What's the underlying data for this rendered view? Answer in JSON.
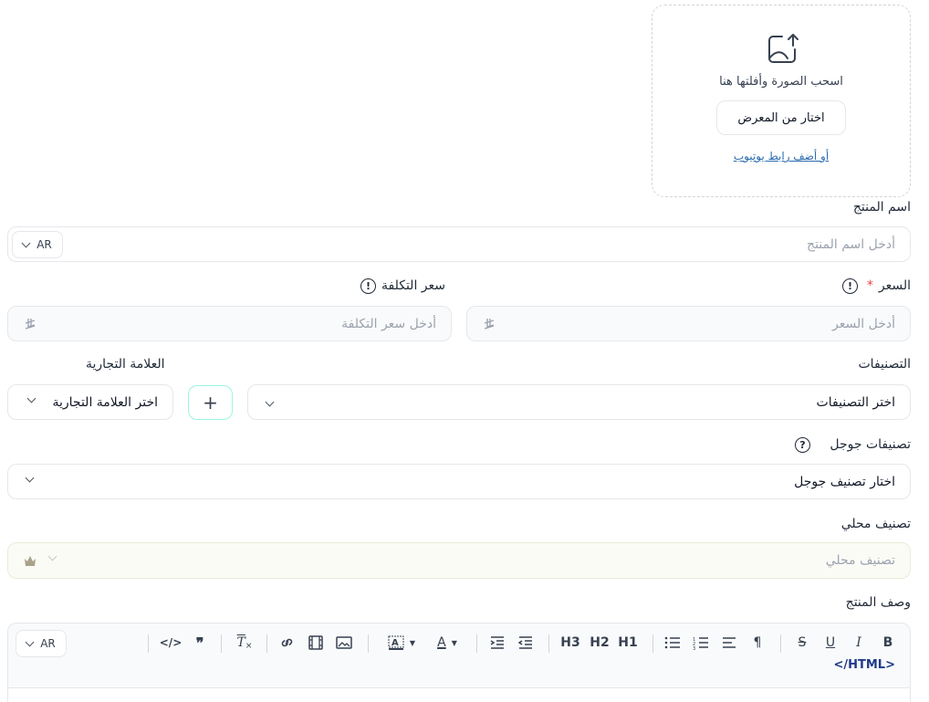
{
  "upload": {
    "drag_text": "اسحب الصورة وأفلتها هنا",
    "gallery_button": "اختار من المعرض",
    "youtube_link": "أو أضف رابط يوتيوب"
  },
  "product_name": {
    "label": "اسم المنتج",
    "placeholder": "أدخل اسم المنتج",
    "lang": "AR"
  },
  "price": {
    "label": "السعر",
    "required_mark": "*",
    "placeholder": "أدخل السعر",
    "currency": "⃁"
  },
  "cost_price": {
    "label": "سعر التكلفة",
    "placeholder": "أدخل سعر التكلفة",
    "currency": "⃁"
  },
  "categories": {
    "label": "التصنيفات",
    "value": "اختر التصنيفات",
    "add_label": "+"
  },
  "brand": {
    "label": "العلامة التجارية",
    "value": "اختر العلامة التجارية"
  },
  "google_categories": {
    "label": "تصنيفات جوجل",
    "value": "اختار تصنيف جوجل",
    "help": "?"
  },
  "local_category": {
    "label": "تصنيف محلي",
    "placeholder": "تصنيف محلي"
  },
  "description": {
    "label": "وصف المنتج",
    "lang": "AR",
    "html_toggle": "</HTML>",
    "toolbar": {
      "bold": "B",
      "italic": "I",
      "underline": "U",
      "strike": "S",
      "paragraph": "¶",
      "h1": "H1",
      "h2": "H2",
      "h3": "H3",
      "quote": "99",
      "code": "</>"
    }
  },
  "info_icon": "!",
  "colors": {
    "accent_border": "#99f6e4",
    "link": "#2b6cb0",
    "required": "#ef4444"
  }
}
